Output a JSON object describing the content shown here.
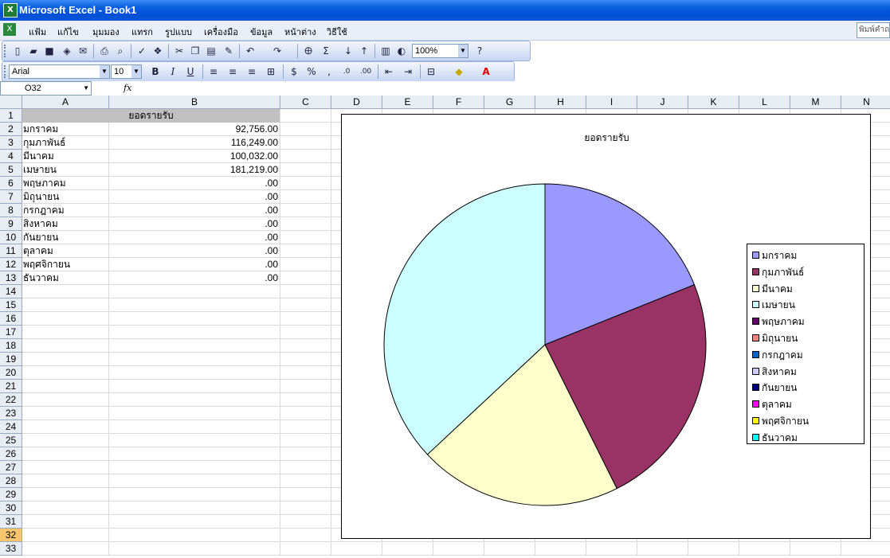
{
  "window": {
    "title": "Microsoft Excel - Book1"
  },
  "menu": {
    "items": [
      "แฟ้ม",
      "แก้ไข",
      "มุมมอง",
      "แทรก",
      "รูปแบบ",
      "เครื่องมือ",
      "ข้อมูล",
      "หน้าต่าง",
      "วิธีใช้"
    ],
    "help_placeholder": "พิมพ์คำถาม"
  },
  "standard_toolbar": {
    "zoom": "100%"
  },
  "format_toolbar": {
    "font": "Arial",
    "size": "10"
  },
  "formula_bar": {
    "name_box": "O32",
    "fx": "fx"
  },
  "columns": [
    "A",
    "B",
    "C",
    "D",
    "E",
    "F",
    "G",
    "H",
    "I",
    "J",
    "K",
    "L",
    "M",
    "N"
  ],
  "rows": [
    "1",
    "2",
    "3",
    "4",
    "5",
    "6",
    "7",
    "8",
    "9",
    "10",
    "11",
    "12",
    "13",
    "14",
    "15",
    "16",
    "17",
    "18",
    "19",
    "20",
    "21",
    "22",
    "23",
    "24",
    "25",
    "26",
    "27",
    "28",
    "29",
    "30",
    "31",
    "32",
    "33"
  ],
  "active_row": "32",
  "sheet": {
    "header": "ยอดรายรับ",
    "rows": [
      {
        "month": "มกราคม",
        "value": "92,756.00"
      },
      {
        "month": "กุมภาพันธ์",
        "value": "116,249.00"
      },
      {
        "month": "มีนาคม",
        "value": "100,032.00"
      },
      {
        "month": "เมษายน",
        "value": "181,219.00"
      },
      {
        "month": "พฤษภาคม",
        "value": ".00"
      },
      {
        "month": "มิถุนายน",
        "value": ".00"
      },
      {
        "month": "กรกฎาคม",
        "value": ".00"
      },
      {
        "month": "สิงหาคม",
        "value": ".00"
      },
      {
        "month": "กันยายน",
        "value": ".00"
      },
      {
        "month": "ตุลาคม",
        "value": ".00"
      },
      {
        "month": "พฤศจิกายน",
        "value": ".00"
      },
      {
        "month": "ธันวาคม",
        "value": ".00"
      }
    ]
  },
  "chart_data": {
    "type": "pie",
    "title": "ยอดรายรับ",
    "categories": [
      "มกราคม",
      "กุมภาพันธ์",
      "มีนาคม",
      "เมษายน",
      "พฤษภาคม",
      "มิถุนายน",
      "กรกฎาคม",
      "สิงหาคม",
      "กันยายน",
      "ตุลาคม",
      "พฤศจิกายน",
      "ธันวาคม"
    ],
    "values": [
      92756,
      116249,
      100032,
      181219,
      0,
      0,
      0,
      0,
      0,
      0,
      0,
      0
    ],
    "colors": [
      "#9999ff",
      "#993366",
      "#ffffcc",
      "#ccffff",
      "#660066",
      "#ff8080",
      "#0066cc",
      "#ccccff",
      "#000080",
      "#ff00ff",
      "#ffff00",
      "#00ffff"
    ],
    "legend": "right"
  }
}
